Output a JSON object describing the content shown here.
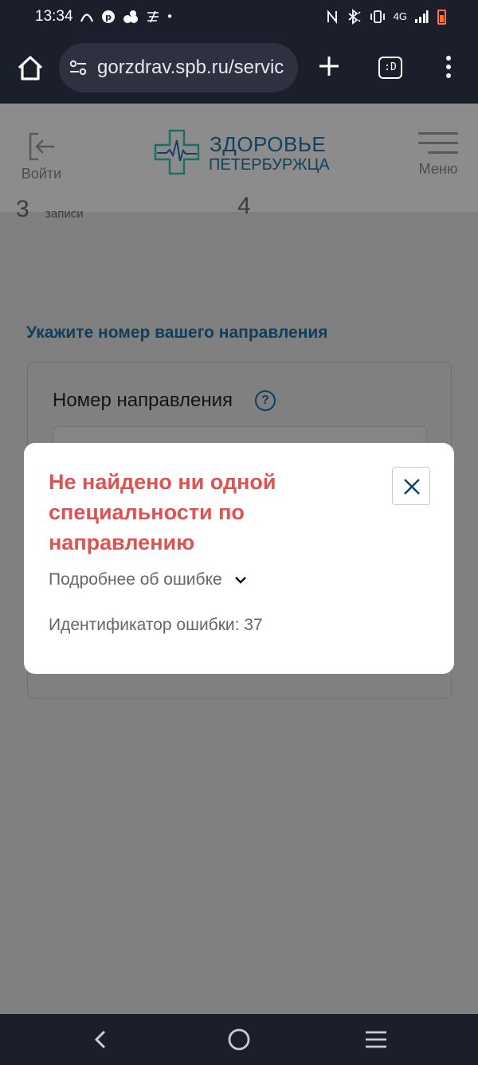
{
  "status_bar": {
    "time": "13:34",
    "network_type": "4G",
    "left_icons": [
      "arc-icon",
      "pinterest-icon",
      "dots-cluster-icon",
      "gesture-icon",
      "dot-icon"
    ],
    "right_icons": [
      "nfc-icon",
      "bluetooth-icon",
      "vibrate-icon",
      "signal-icon",
      "battery-icon"
    ],
    "battery_color": "#ff7043"
  },
  "browser": {
    "url": "gorzdrav.spb.ru/servic",
    "tab_button_label": ":D"
  },
  "site_header": {
    "login_label": "Войти",
    "logo_line1": "ЗДОРОВЬЕ",
    "logo_line2": "ПЕТЕРБУРЖЦА",
    "menu_label": "Меню",
    "brand_color": "#12405e",
    "accent_color": "#1a9a86"
  },
  "page": {
    "step_number_left": "3",
    "step_caption": "записи",
    "step_number_right": "4",
    "section_title": "Укажите номер вашего направления",
    "field_label": "Номер направления",
    "help_icon": "?"
  },
  "modal": {
    "title": "Не найдено ни одной специальности по направлению",
    "details_label": "Подробнее об ошибке",
    "error_id_text": "Идентификатор ошибки: 37",
    "title_color": "#e05252"
  },
  "nav": {
    "icons": [
      "back-icon",
      "home-circle-icon",
      "recents-icon"
    ]
  }
}
